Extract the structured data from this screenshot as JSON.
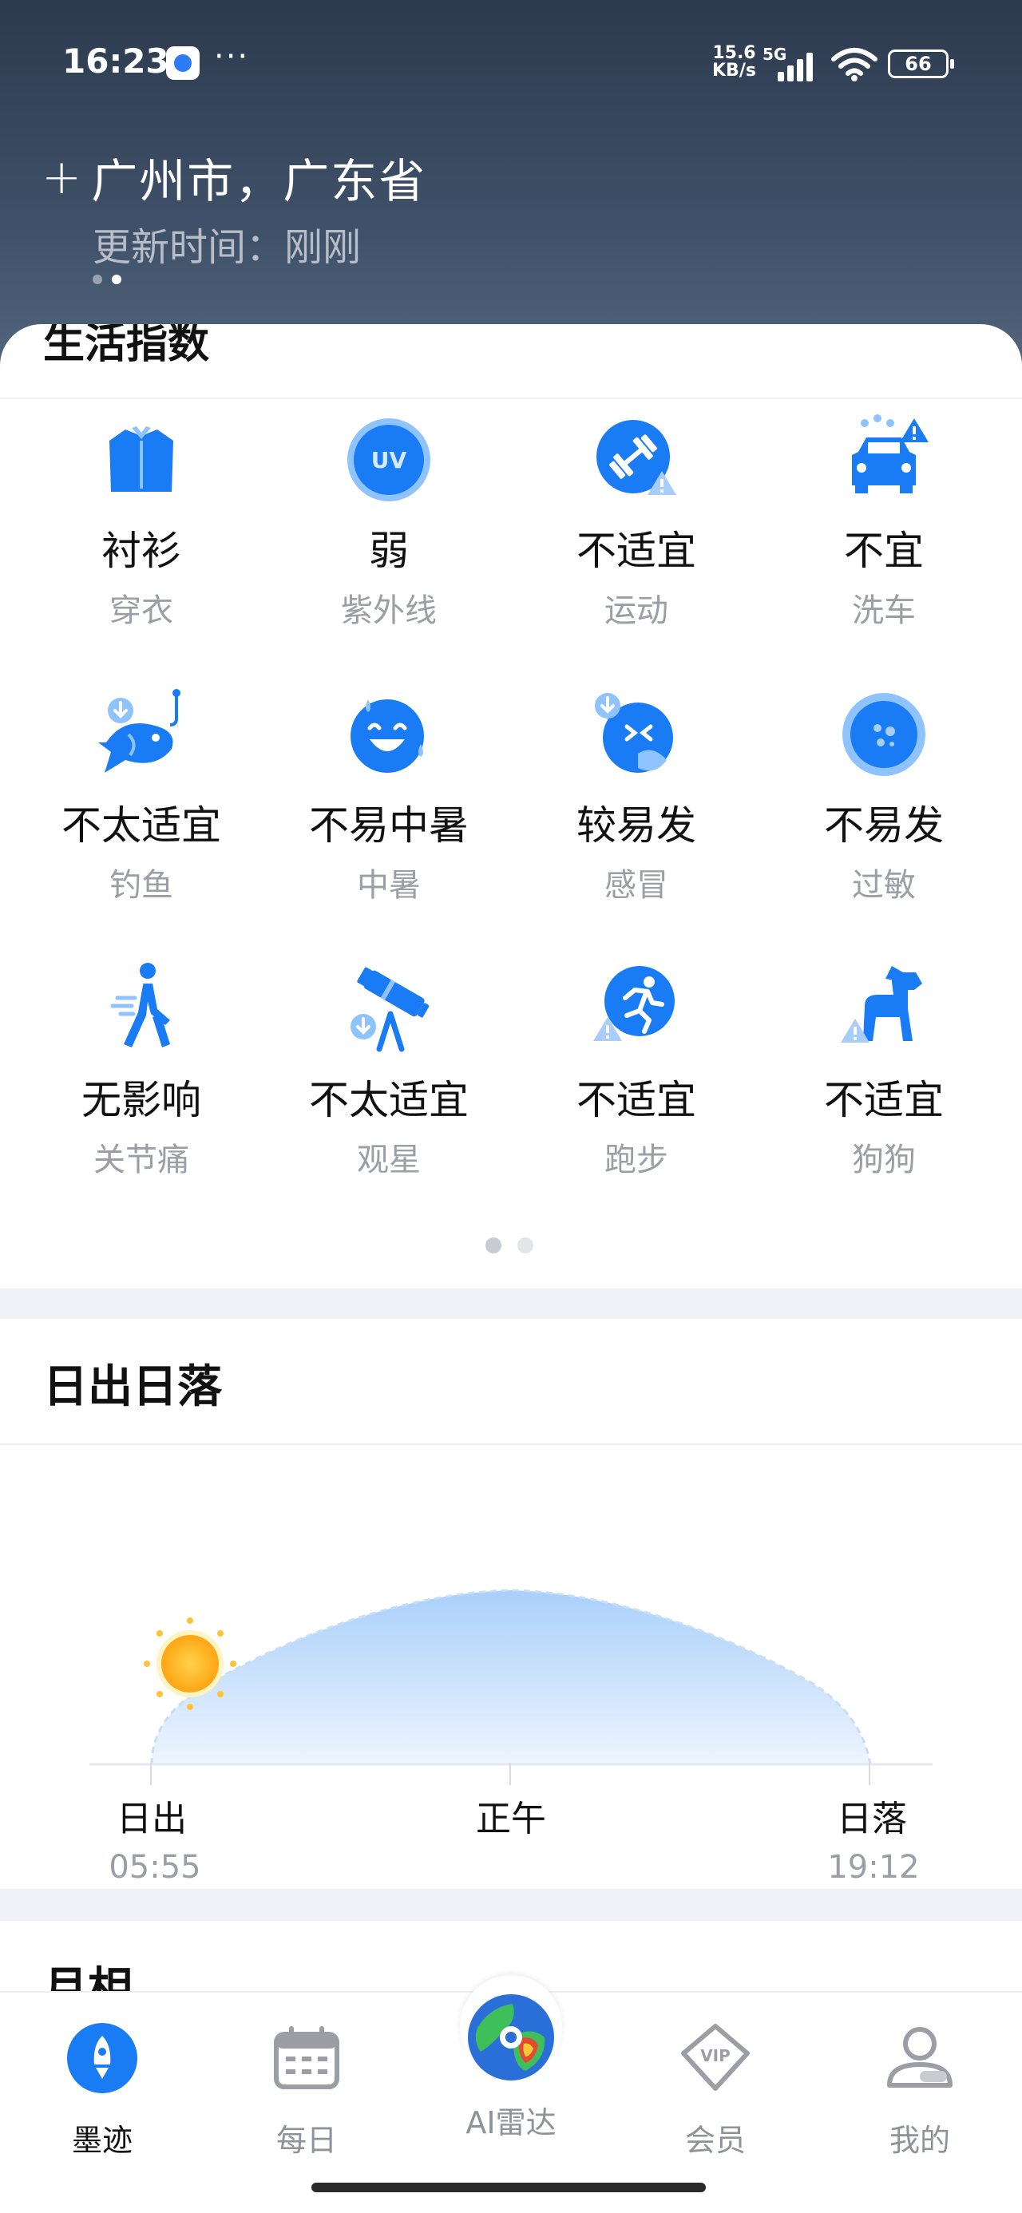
{
  "status_bar": {
    "time": "16:23",
    "more": "···",
    "speed_value": "15.6",
    "speed_unit": "KB/s",
    "network": "5G",
    "battery": "66"
  },
  "location": {
    "city": "广州市，广东省",
    "update_time": "更新时间：刚刚"
  },
  "life_index": {
    "title": "生活指数",
    "items": [
      {
        "value": "衬衫",
        "label": "穿衣",
        "icon": "shirt-icon"
      },
      {
        "value": "弱",
        "label": "紫外线",
        "icon": "uv-icon",
        "icon_text": "UV"
      },
      {
        "value": "不适宜",
        "label": "运动",
        "icon": "dumbbell-icon"
      },
      {
        "value": "不宜",
        "label": "洗车",
        "icon": "car-wash-icon"
      },
      {
        "value": "不太适宜",
        "label": "钓鱼",
        "icon": "fish-icon"
      },
      {
        "value": "不易中暑",
        "label": "中暑",
        "icon": "heatstroke-face-icon"
      },
      {
        "value": "较易发",
        "label": "感冒",
        "icon": "cold-face-icon"
      },
      {
        "value": "不易发",
        "label": "过敏",
        "icon": "allergy-icon"
      },
      {
        "value": "无影响",
        "label": "关节痛",
        "icon": "walking-person-icon"
      },
      {
        "value": "不太适宜",
        "label": "观星",
        "icon": "telescope-icon"
      },
      {
        "value": "不适宜",
        "label": "跑步",
        "icon": "running-icon"
      },
      {
        "value": "不适宜",
        "label": "狗狗",
        "icon": "dog-icon"
      }
    ],
    "page_count": 2,
    "active_page": 0
  },
  "sun": {
    "title": "日出日落",
    "sunrise_label": "日出",
    "sunrise_time": "05:55",
    "noon_label": "正午",
    "sunset_label": "日落",
    "sunset_time": "19:12",
    "sun_progress": 0
  },
  "moon": {
    "title": "月相"
  },
  "bottom_nav": [
    {
      "label": "墨迹",
      "icon": "rocket-icon",
      "active": true
    },
    {
      "label": "每日",
      "icon": "calendar-icon",
      "active": false
    },
    {
      "label": "AI雷达",
      "icon": "radar-globe-icon",
      "active": false
    },
    {
      "label": "会员",
      "icon": "vip-diamond-icon",
      "active": false,
      "icon_text": "VIP"
    },
    {
      "label": "我的",
      "icon": "profile-icon",
      "active": false
    }
  ],
  "colors": {
    "accent": "#1a7cf5",
    "icon_light": "#8fc3ff",
    "warning": "#a9cdfa",
    "sun": "#ffb21e"
  }
}
